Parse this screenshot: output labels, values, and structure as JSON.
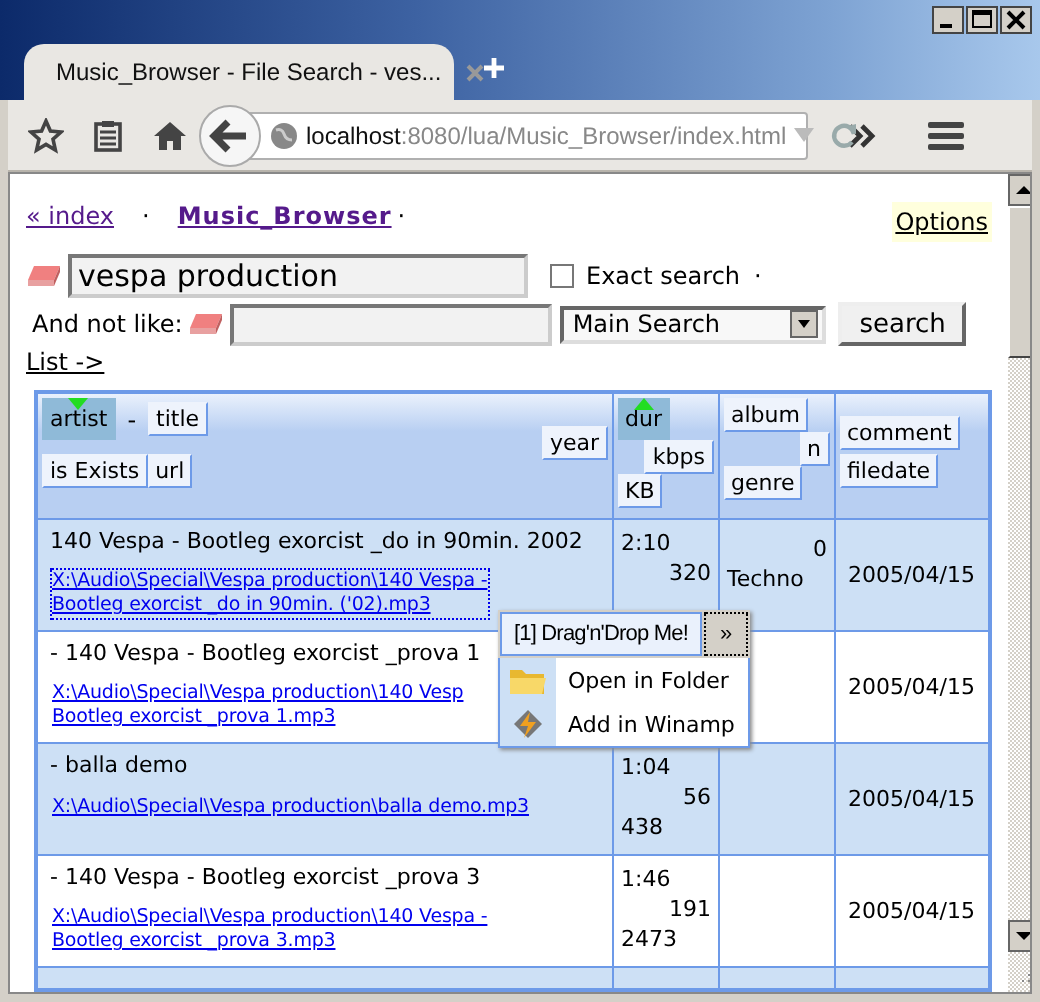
{
  "browser": {
    "tab_title": "Music_Browser - File Search - ves...",
    "url_host": "localhost",
    "url_path": ":8080/lua/Music_Browser/index.html"
  },
  "nav": {
    "index_link": "« index",
    "separator_1": "·",
    "app_link": "Music_Browser",
    "separator_2": "·",
    "options_link": "Options"
  },
  "search": {
    "value": "vespa production",
    "exact_search": {
      "label": "Exact search",
      "checked": false
    },
    "separator": "·",
    "exclude_label": "And not like:",
    "mode": "Main Search",
    "button": "search"
  },
  "list_link": "List ->",
  "table": {
    "header": [
      {
        "lines": [
          [
            {
              "kind": "sort",
              "label": "artist",
              "selected": true,
              "ascending": false
            },
            {
              "kind": "separator",
              "label": "-"
            },
            {
              "kind": "sort",
              "label": "title",
              "selected": false
            }
          ],
          [
            {
              "kind": "sort",
              "label": "is Exists",
              "selected": false
            },
            {
              "kind": "sort",
              "label": "url",
              "selected": false
            }
          ]
        ],
        "side": [
          {
            "kind": "sort",
            "label": "year",
            "selected": false
          }
        ]
      },
      {
        "lines": [
          [
            {
              "kind": "sort",
              "label": "dur",
              "selected": true,
              "ascending": true
            }
          ],
          [
            {
              "kind": "sort",
              "label": "kbps",
              "selected": false
            }
          ],
          [
            {
              "kind": "sort",
              "label": "KB",
              "selected": false
            }
          ]
        ]
      },
      {
        "lines": [
          [
            {
              "kind": "sort",
              "label": "album",
              "selected": false
            }
          ],
          [
            {
              "kind": "sort",
              "label": "n",
              "selected": false
            }
          ],
          [
            {
              "kind": "sort",
              "label": "genre",
              "selected": false
            }
          ]
        ]
      },
      {
        "lines": [
          [
            {
              "kind": "sort",
              "label": "comment",
              "selected": false
            }
          ],
          [
            {
              "kind": "sort",
              "label": "filedate",
              "selected": false
            }
          ]
        ]
      }
    ],
    "rows": [
      {
        "title": "140 Vespa - Bootleg exorcist _do in 90min. 2002",
        "path": [
          "X:\\Audio\\Special\\Vespa production\\140 Vespa -",
          "Bootleg exorcist _do in 90min. ('02).mp3"
        ],
        "focused": true,
        "duration": "2:10",
        "bitrate": "320",
        "track": "0",
        "genre": "Techno",
        "date": "2005/04/15"
      },
      {
        "title": "- 140 Vespa - Bootleg exorcist _prova 1",
        "path": [
          "X:\\Audio\\Special\\Vespa production\\140 Vesp",
          "Bootleg exorcist _prova 1.mp3"
        ],
        "focused": false,
        "date": "2005/04/15"
      },
      {
        "title": "- balla demo",
        "path": [
          "X:\\Audio\\Special\\Vespa production\\balla demo.mp3"
        ],
        "focused": false,
        "duration": "1:04",
        "bitrate": "56",
        "size": "438",
        "date": "2005/04/15"
      },
      {
        "title": "- 140 Vespa - Bootleg exorcist _prova 3",
        "path": [
          "X:\\Audio\\Special\\Vespa production\\140 Vespa -",
          "Bootleg exorcist _prova 3.mp3"
        ],
        "focused": false,
        "duration": "1:46",
        "bitrate": "191",
        "size": "2473",
        "date": "2005/04/15"
      }
    ]
  },
  "popup": {
    "drag_button": "[1] Drag'n'Drop Me!",
    "more_button": "»",
    "items": [
      {
        "label": "Open in Folder",
        "kind": "folder"
      },
      {
        "label": "Add in Winamp",
        "kind": "winamp"
      }
    ]
  }
}
